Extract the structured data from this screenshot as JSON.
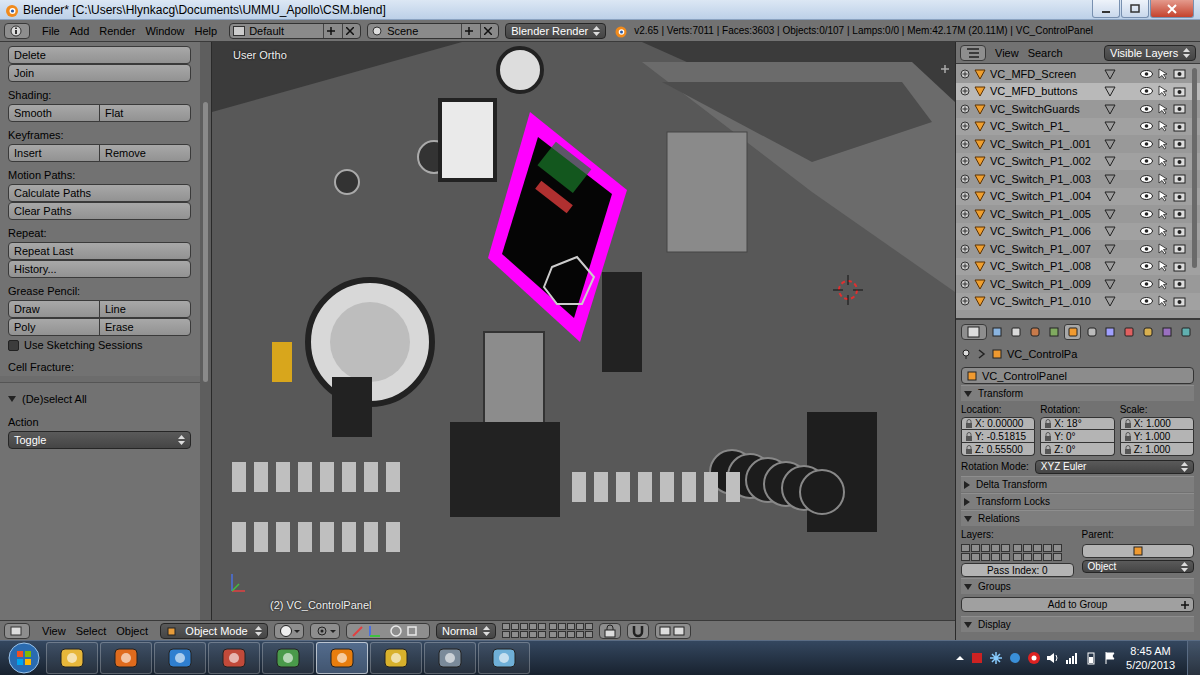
{
  "window": {
    "title": "Blender* [C:\\Users\\Hlynkacg\\Documents\\UMMU_Apollo\\CSM.blend]"
  },
  "info_header": {
    "menus": [
      "File",
      "Add",
      "Render",
      "Window",
      "Help"
    ],
    "screen_layout": "Default",
    "scene": "Scene",
    "render_engine": "Blender Render",
    "stats": "v2.65 | Verts:7011 | Faces:3603 | Objects:0/107 | Lamps:0/0 | Mem:42.17M (20.11M) | VC_ControlPanel"
  },
  "tool_shelf": {
    "rows": [
      {
        "kind": "buttons",
        "buttons": [
          "Delete"
        ]
      },
      {
        "kind": "buttons",
        "buttons": [
          "Join"
        ]
      },
      {
        "kind": "label",
        "text": "Shading:"
      },
      {
        "kind": "buttons",
        "buttons": [
          "Smooth",
          "Flat"
        ]
      },
      {
        "kind": "label",
        "text": "Keyframes:"
      },
      {
        "kind": "buttons",
        "buttons": [
          "Insert",
          "Remove"
        ]
      },
      {
        "kind": "label",
        "text": "Motion Paths:"
      },
      {
        "kind": "buttons",
        "buttons": [
          "Calculate Paths"
        ]
      },
      {
        "kind": "buttons",
        "buttons": [
          "Clear Paths"
        ]
      },
      {
        "kind": "label",
        "text": "Repeat:"
      },
      {
        "kind": "buttons",
        "buttons": [
          "Repeat Last"
        ]
      },
      {
        "kind": "buttons",
        "buttons": [
          "History..."
        ]
      },
      {
        "kind": "label",
        "text": "Grease Pencil:"
      },
      {
        "kind": "buttons",
        "buttons": [
          "Draw",
          "Line"
        ]
      },
      {
        "kind": "buttons",
        "buttons": [
          "Poly",
          "Erase"
        ]
      },
      {
        "kind": "checkbox",
        "text": "Use Sketching Sessions",
        "checked": false
      },
      {
        "kind": "label",
        "text": "Cell Fracture:"
      }
    ]
  },
  "operator_panel": {
    "title": "(De)select All",
    "expanded": true,
    "label": "Action",
    "value": "Toggle"
  },
  "viewport": {
    "view_name": "User Ortho",
    "object_label": "(2) VC_ControlPanel"
  },
  "viewport_header": {
    "menus": [
      "View",
      "Select",
      "Object"
    ],
    "mode": "Object Mode",
    "orientation": "Normal"
  },
  "outliner": {
    "menus": [
      "View",
      "Search"
    ],
    "filter": "Visible Layers",
    "items": [
      {
        "name": "VC_MFD_Screen",
        "selected": false
      },
      {
        "name": "VC_MFD_buttons",
        "selected": true
      },
      {
        "name": "VC_SwitchGuards",
        "selected": false
      },
      {
        "name": "VC_Switch_P1_",
        "selected": false
      },
      {
        "name": "VC_Switch_P1_.001",
        "selected": false
      },
      {
        "name": "VC_Switch_P1_.002",
        "selected": false
      },
      {
        "name": "VC_Switch_P1_.003",
        "selected": false
      },
      {
        "name": "VC_Switch_P1_.004",
        "selected": false
      },
      {
        "name": "VC_Switch_P1_.005",
        "selected": false
      },
      {
        "name": "VC_Switch_P1_.006",
        "selected": false
      },
      {
        "name": "VC_Switch_P1_.007",
        "selected": false
      },
      {
        "name": "VC_Switch_P1_.008",
        "selected": false
      },
      {
        "name": "VC_Switch_P1_.009",
        "selected": false
      },
      {
        "name": "VC_Switch_P1_.010",
        "selected": false
      }
    ]
  },
  "properties": {
    "tabs": [
      {
        "selected": false
      },
      {
        "selected": false
      },
      {
        "selected": false
      },
      {
        "selected": false
      },
      {
        "selected": true
      },
      {
        "selected": false
      },
      {
        "selected": false
      },
      {
        "selected": false
      },
      {
        "selected": false
      },
      {
        "selected": false
      },
      {
        "selected": false
      }
    ],
    "breadcrumb": "VC_ControlPa",
    "object_name": "VC_ControlPanel",
    "transform": {
      "title": "Transform",
      "expanded": true,
      "columns": [
        {
          "label": "Location:",
          "fields": [
            "X: 0.00000",
            "Y: -0.51815",
            "Z: 0.55500"
          ]
        },
        {
          "label": "Rotation:",
          "fields": [
            "X: 18°",
            "Y: 0°",
            "Z: 0°"
          ]
        },
        {
          "label": "Scale:",
          "fields": [
            "X: 1.000",
            "Y: 1.000",
            "Z: 1.000"
          ]
        }
      ],
      "rotation_mode_label": "Rotation Mode:",
      "rotation_mode": "XYZ Euler"
    },
    "collapsed_panels": [
      {
        "title": "Delta Transform",
        "expanded": false
      },
      {
        "title": "Transform Locks",
        "expanded": false
      }
    ],
    "relations": {
      "title": "Relations",
      "expanded": true,
      "layers_label": "Layers:",
      "parent_label": "Parent:",
      "parent_type": "Object",
      "pass_index": "Pass Index: 0"
    },
    "groups": {
      "title": "Groups",
      "expanded": true,
      "button": "Add to Group"
    },
    "display": {
      "title": "Display",
      "expanded": true
    }
  },
  "taskbar": {
    "apps": [
      {
        "active": false
      },
      {
        "active": false
      },
      {
        "active": false
      },
      {
        "active": false
      },
      {
        "active": false
      },
      {
        "active": true
      },
      {
        "active": false
      },
      {
        "active": false
      },
      {
        "active": false
      }
    ],
    "time": "8:45 AM",
    "date": "5/20/2013"
  }
}
